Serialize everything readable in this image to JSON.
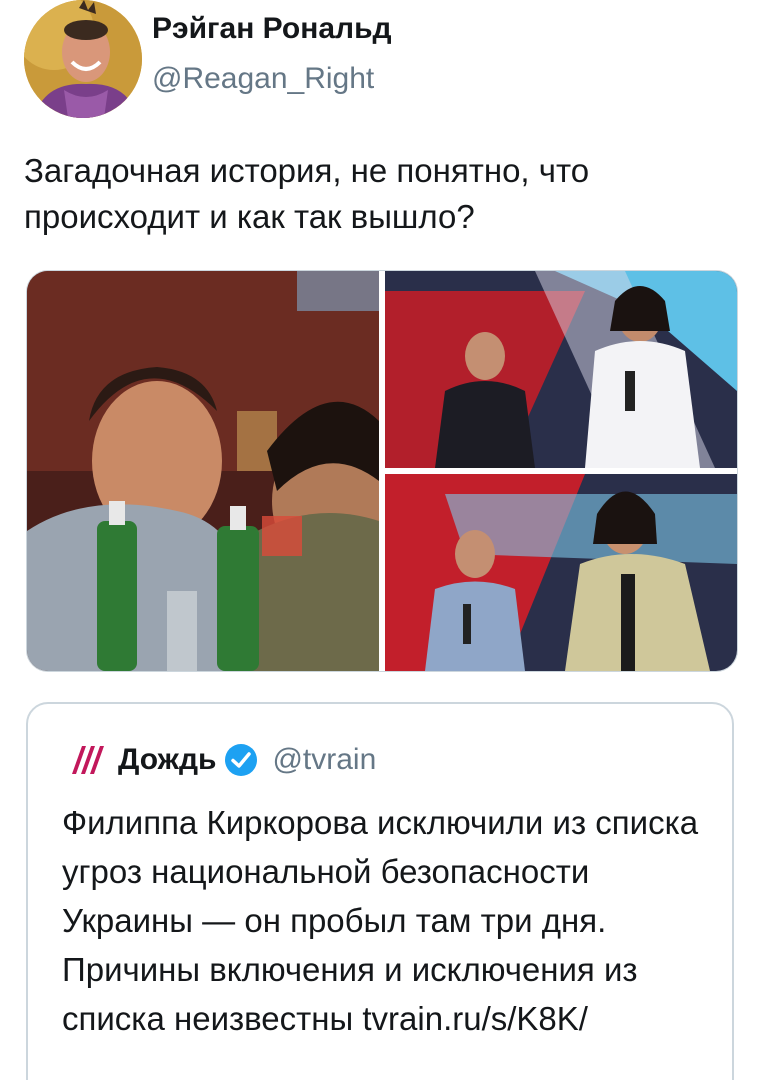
{
  "author": {
    "display_name": "Рэйган Рональд",
    "handle": "@Reagan_Right"
  },
  "tweet": {
    "text": "Загадочная история, не понятно, что происходит и как так вышло?"
  },
  "media": {
    "count": 3
  },
  "quoted_tweet": {
    "display_name": "Дождь",
    "handle": "@tvrain",
    "verified": true,
    "text": "Филиппа Киркорова исключили из списка угроз национальной безопасности Украины — он пробыл там три дня. Причины включения и исключения из списка неизвестны tvrain.ru/s/K8K/"
  },
  "colors": {
    "text": "#14171a",
    "secondary_text": "#657786",
    "border": "#ccd6dd",
    "verified_blue": "#1da1f2",
    "rain_logo": "#c2185b"
  }
}
